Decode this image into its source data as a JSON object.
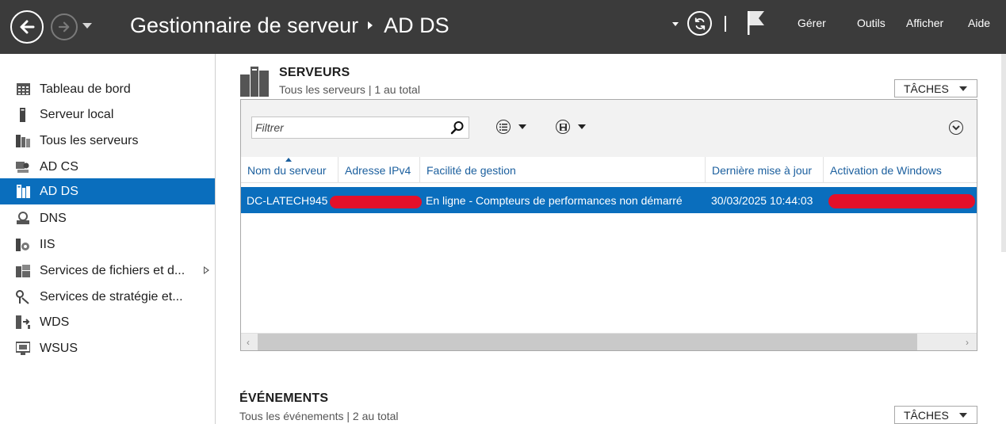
{
  "titlebar": {
    "app_title": "Gestionnaire de serveur",
    "current_page": "AD DS",
    "menus": [
      "Gérer",
      "Outils",
      "Afficher",
      "Aide"
    ]
  },
  "sidebar": {
    "items": [
      {
        "label": "Tableau de bord",
        "icon": "dashboard-icon"
      },
      {
        "label": "Serveur local",
        "icon": "local-server-icon"
      },
      {
        "label": "Tous les serveurs",
        "icon": "all-servers-icon"
      },
      {
        "label": "AD CS",
        "icon": "certificate-services-icon"
      },
      {
        "label": "AD DS",
        "icon": "directory-services-icon",
        "active": true
      },
      {
        "label": "DNS",
        "icon": "dns-icon"
      },
      {
        "label": "IIS",
        "icon": "iis-icon"
      },
      {
        "label": "Services de fichiers et d...",
        "icon": "file-services-icon",
        "has_submenu": true
      },
      {
        "label": "Services de stratégie et...",
        "icon": "policy-services-icon"
      },
      {
        "label": "WDS",
        "icon": "wds-icon"
      },
      {
        "label": "WSUS",
        "icon": "wsus-icon"
      }
    ]
  },
  "servers": {
    "title": "SERVEURS",
    "subtitle": "Tous les serveurs | 1 au total",
    "tasks_label": "TÂCHES",
    "filter_placeholder": "Filtrer",
    "columns": [
      "Nom du serveur",
      "Adresse IPv4",
      "Facilité de gestion",
      "Dernière mise à jour",
      "Activation de Windows"
    ],
    "rows": [
      {
        "name": "DC-LATECH945",
        "ipv4": "",
        "manageability": "En ligne - Compteurs de performances non démarré",
        "last_update": "30/03/2025 10:44:03",
        "activation": ""
      }
    ]
  },
  "events": {
    "title": "ÉVÉNEMENTS",
    "subtitle": "Tous les événements | 2 au total",
    "tasks_label": "TÂCHES"
  },
  "colors": {
    "titlebar_bg": "#3b3b3b",
    "accent": "#0a6ebd",
    "header_text": "#1b5f9e",
    "redaction": "#e3102a"
  }
}
